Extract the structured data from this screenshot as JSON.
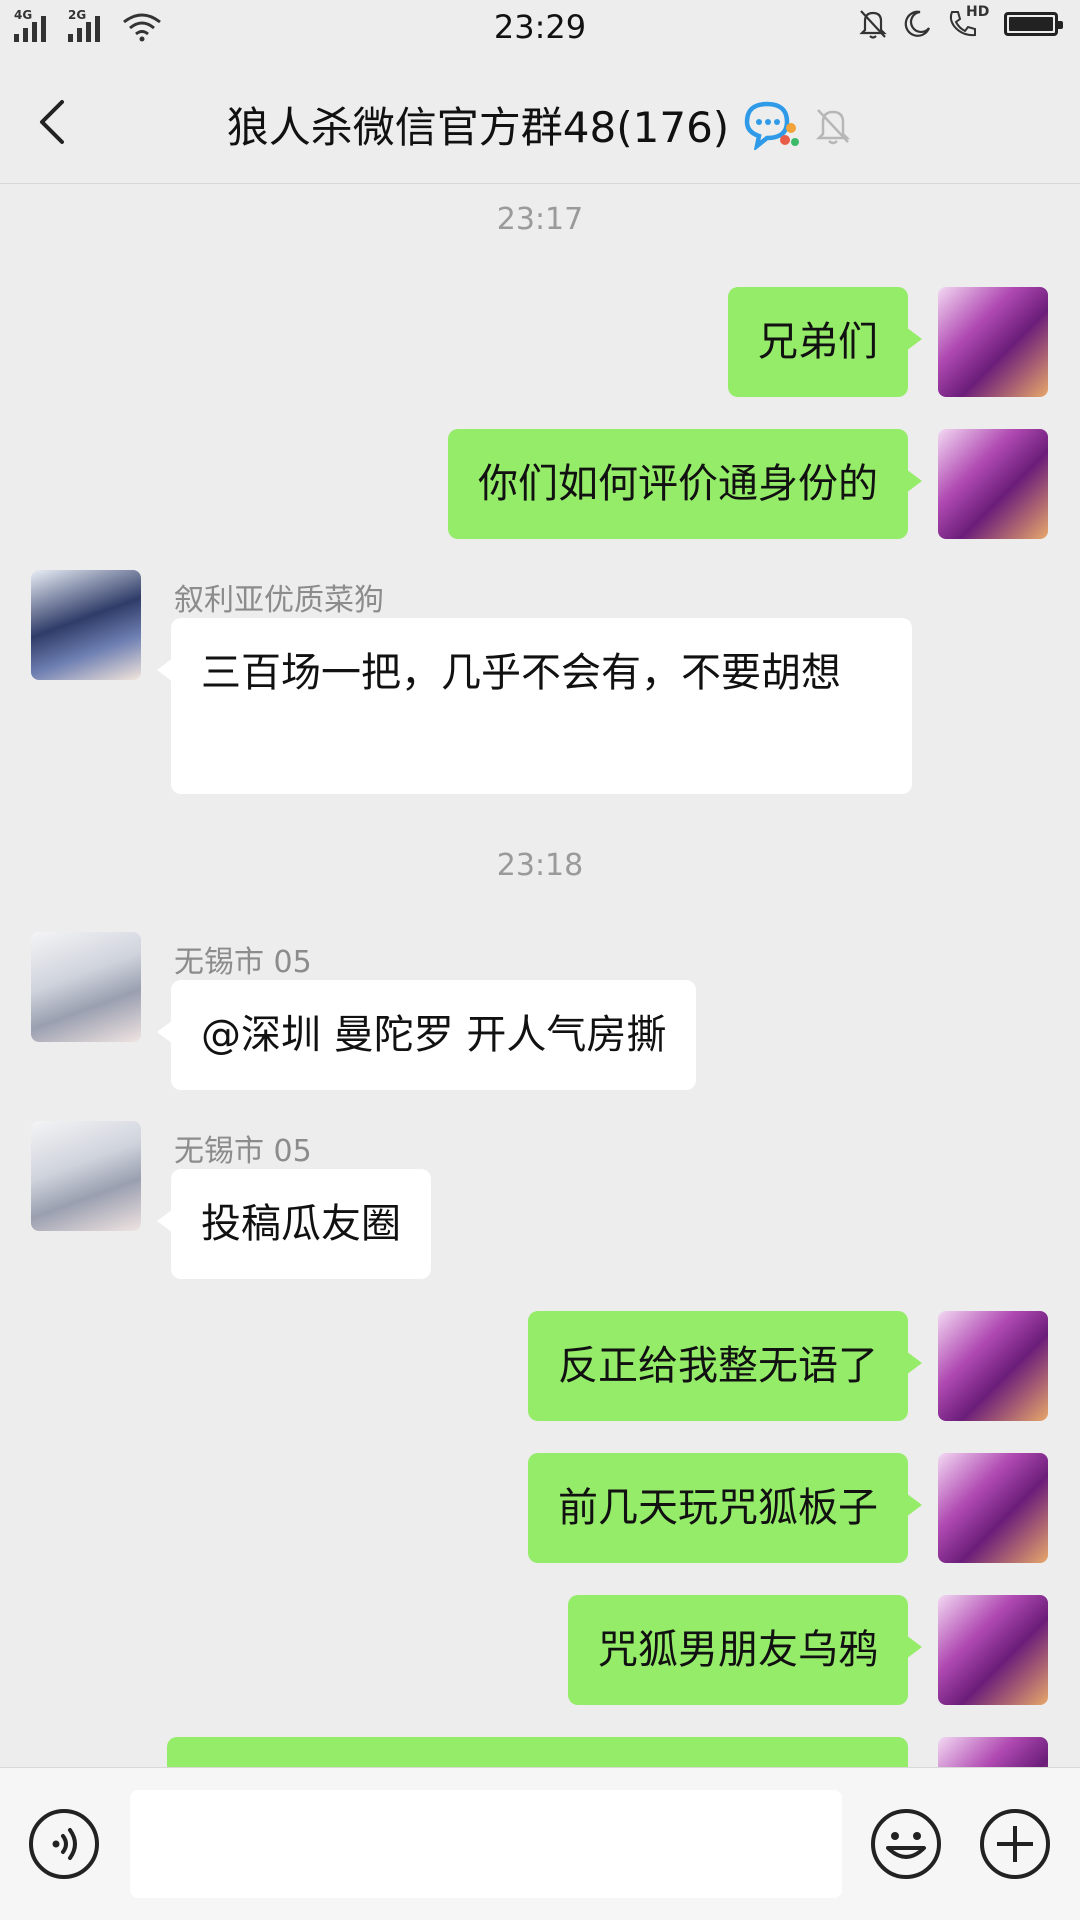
{
  "status_bar": {
    "signal_1_label": "4G",
    "signal_2_label": "2G",
    "time": "23:29",
    "hd_label": "HD"
  },
  "header": {
    "title": "狼人杀微信官方群48(176)",
    "back_icon": "chevron-left-icon",
    "group_badge_icon": "chat-bubble-icon",
    "mute_icon": "bell-off-icon"
  },
  "chat": {
    "dividers": [
      "23:17",
      "23:18"
    ],
    "messages": [
      {
        "side": "me",
        "text": "兄弟们"
      },
      {
        "side": "me",
        "text": "你们如何评价通身份的"
      },
      {
        "side": "other",
        "sender": "叙利亚优质菜狗",
        "text": "三百场一把，几乎不会有，不要胡想"
      },
      {
        "side": "other",
        "sender": "无锡市 05",
        "text": "@深圳 曼陀罗  开人气房撕"
      },
      {
        "side": "other",
        "sender": "无锡市 05",
        "text": "投稿瓜友圈"
      },
      {
        "side": "me",
        "text": "反正给我整无语了"
      },
      {
        "side": "me",
        "text": "前几天玩咒狐板子"
      },
      {
        "side": "me",
        "text": "咒狐男朋友乌鸦"
      },
      {
        "side": "me",
        "text": ""
      }
    ]
  },
  "input_bar": {
    "voice_icon": "voice-icon",
    "input_value": "",
    "emoji_icon": "emoji-icon",
    "plus_icon": "plus-icon"
  },
  "colors": {
    "background": "#ededed",
    "bubble_me": "#95ec69",
    "bubble_other": "#ffffff",
    "meta_text": "#9a9a9a"
  }
}
